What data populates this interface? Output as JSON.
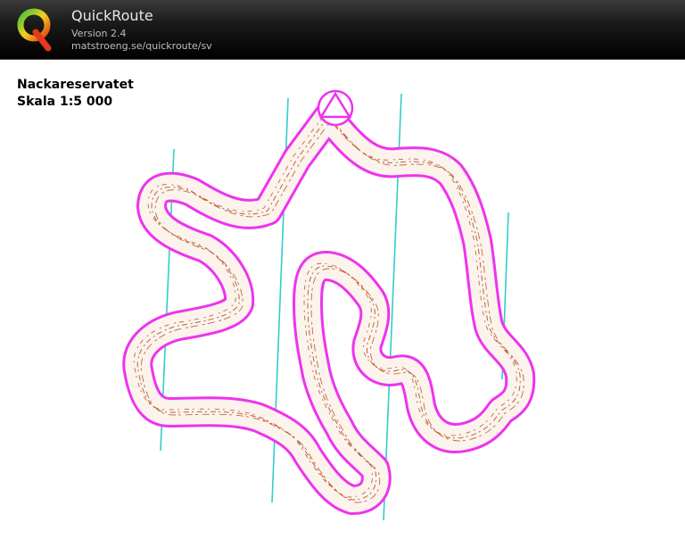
{
  "app": {
    "title": "QuickRoute",
    "version": "Version 2.4",
    "url": "matstroeng.se/quickroute/sv"
  },
  "map": {
    "name": "Nackareservatet",
    "scale": "Skala 1:5 000",
    "route_color": "#ee33ee",
    "meridian_color": "#33cccc",
    "contour_color": "#b0542a"
  }
}
